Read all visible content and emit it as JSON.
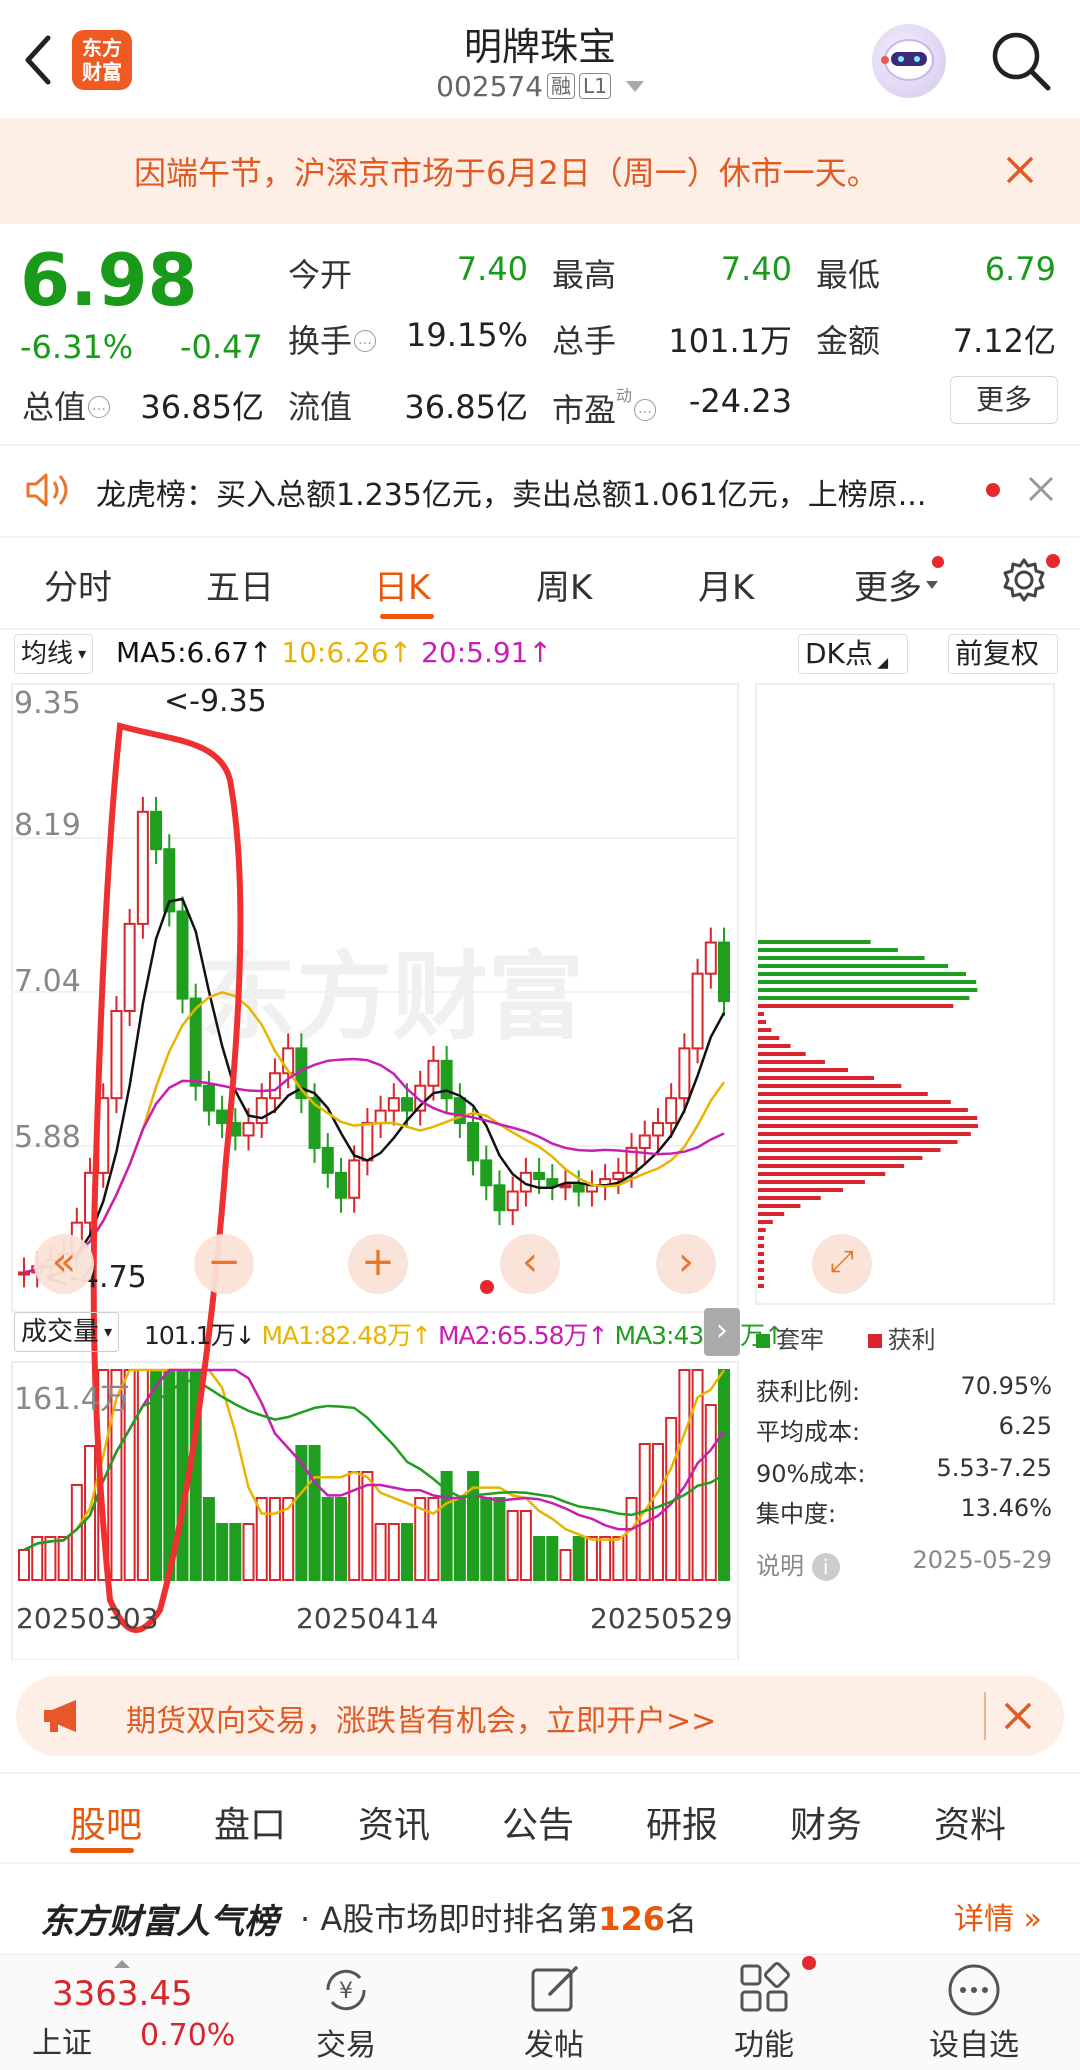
{
  "header": {
    "logo_text": "东方财富",
    "stock_name": "明牌珠宝",
    "stock_code": "002574",
    "tag_margin": "融",
    "tag_level": "L1"
  },
  "notice": {
    "text": "因端午节，沪深京市场于6月2日（周一）休市一天。"
  },
  "quote": {
    "price": "6.98",
    "change_pct": "-6.31%",
    "change_amt": "-0.47",
    "fields": {
      "open_label": "今开",
      "open": "7.40",
      "high_label": "最高",
      "high": "7.40",
      "low_label": "最低",
      "low": "6.79",
      "turnover_label": "换手",
      "turnover": "19.15%",
      "volume_label": "总手",
      "volume": "101.1万",
      "amount_label": "金额",
      "amount": "7.12亿",
      "mktcap_label": "总值",
      "mktcap": "36.85亿",
      "float_label": "流值",
      "float": "36.85亿",
      "pe_label": "市盈",
      "pe_sup": "动",
      "pe": "-24.23"
    },
    "more_label": "更多"
  },
  "dragon_tiger": {
    "text": "龙虎榜：买入总额1.235亿元，卖出总额1.061亿元，上榜原..."
  },
  "tabs": [
    "分时",
    "五日",
    "日K",
    "周K",
    "月K",
    "更多"
  ],
  "active_tab": "日K",
  "indicators": {
    "ma_selector": "均线",
    "ma5": "MA5:6.67↑",
    "ma10": "10:6.26↑",
    "ma20": "20:5.91↑",
    "dk_label": "DK点",
    "adjust_label": "前复权",
    "colors": {
      "ma5": "#111111",
      "ma10": "#e8b400",
      "ma20": "#c81eb4",
      "up": "#d7262c",
      "down": "#1f9e1f"
    }
  },
  "price_axis": [
    "9.35",
    "8.19",
    "7.04",
    "5.88"
  ],
  "max_marker": "<-9.35",
  "min_marker": "<-4.75",
  "watermark": "东方财富",
  "volume_panel": {
    "selector": "成交量",
    "vol": "101.1万↓",
    "ma1": "MA1:82.48万↑",
    "ma2": "MA2:65.58万↑",
    "ma3": "MA3:43.39万↑",
    "max_label": "161.4万"
  },
  "date_axis": [
    "20250303",
    "20250414",
    "20250529"
  ],
  "chips": {
    "legend_trapped": "套牢",
    "legend_profit": "获利",
    "stats": [
      {
        "label": "获利比例:",
        "value": "70.95%"
      },
      {
        "label": "平均成本:",
        "value": "6.25"
      },
      {
        "label": "90%成本:",
        "value": "5.53-7.25"
      },
      {
        "label": "集中度:",
        "value": "13.46%"
      }
    ],
    "note_label": "说明",
    "date": "2025-05-29"
  },
  "futures_ad": {
    "text": "期货双向交易，涨跌皆有机会，立即开户>>"
  },
  "bottom_tabs": [
    "股吧",
    "盘口",
    "资讯",
    "公告",
    "研报",
    "财务",
    "资料"
  ],
  "active_bottom_tab": "股吧",
  "ranking": {
    "title": "东方财富人气榜",
    "prefix": "· A股市场即时排名第",
    "rank": "126",
    "suffix": "名",
    "detail": "详情"
  },
  "bottom_nav": {
    "index_value": "3363.45",
    "index_name": "上证",
    "index_change": "0.70%",
    "items": [
      "交易",
      "发帖",
      "功能",
      "设自选"
    ]
  }
}
